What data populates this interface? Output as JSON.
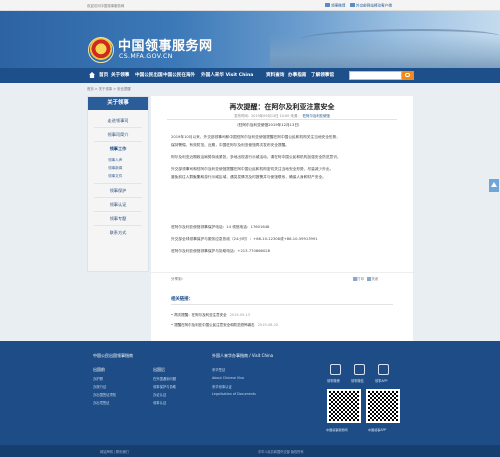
{
  "topbar": {
    "welcome": "欢迎访问中国领事服务网",
    "link_weibo": "领事微博",
    "link_app": "外交部网站移动客户端"
  },
  "header": {
    "title": "中国领事服务网",
    "domain": "CS.MFA.GOV.CN"
  },
  "nav": {
    "items": [
      "首页",
      "关于领事",
      "中国公民出国",
      "中国公民在海外",
      "外国人来华 Visit China",
      "资料查询",
      "办事指南",
      "了解领事馆"
    ]
  },
  "breadcrumb": {
    "items": [
      "首页",
      "关于领事",
      "安全提醒"
    ]
  },
  "sidebar": {
    "heading": "关于领事",
    "items": [
      {
        "label": "走进领事司"
      },
      {
        "label": "领事司简介"
      },
      {
        "label": "领事工作"
      },
      {
        "label": "领事保护"
      },
      {
        "label": "领事认证"
      },
      {
        "label": "领事专题"
      },
      {
        "label": "联系方式"
      }
    ],
    "subitems": [
      "领事人声",
      "领事新闻",
      "领事文件"
    ]
  },
  "article": {
    "title": "再次提醒：在阿尔及利亚注意安全",
    "meta_date": "发布时间：2019年09月13日 15:00  来源：",
    "meta_source": "驻阿尔及利亚使馆",
    "note": "（驻阿尔及利亚使馆2019年12月13日）",
    "paragraphs": [
      "2019年10月以来，外交部领事司和中国驻阿尔及利亚使馆提醒在阿中国公民和机构关注当地安全形势，",
      "保持警惕，有效防范。近期，中国驻阿尔及利亚使馆再次发布安全提醒。",
      "阿尔及利亚近期政治局势持续紧张，多地出现游行示威活动，请在阿中国公民和机构加强安全防范意识。",
      "外交部领事司和驻阿尔及利亚使馆提醒在阿中国公民和机构密切关注当地安全形势，尽量减少外出，",
      "避免前往人群聚集和游行示威区域，遇突发情况及时报警并与使馆联系，确保人身和财产安全。",
      "外交部全球领事保护与服务应急热线（24小时）：+86-10-12308或+86-10-59913991",
      "驻阿尔及利亚使馆领事保护与协助电话：+213-770866028"
    ],
    "hotline": "外交部全球领事保护与服务应急热线（24小时）：+86-10-12308或+86-10-59913991",
    "embassy_phone_label": "驻阿尔及利亚使馆领事保护电话：14  领馆电话：17601648",
    "embassy_phone": "驻阿尔及利亚使馆领事保护与协助电话：+213-770866028"
  },
  "share": {
    "label": "分享到：",
    "actions": [
      "打印",
      "关闭"
    ]
  },
  "related": {
    "title": "相关链接：",
    "items": [
      {
        "text": "再次提醒：在阿尔及利亚注意安全",
        "date": "2019-09-13"
      },
      {
        "text": "提醒在阿尔及利亚中国公民注意安全和防范恐怖袭击",
        "date": "2019-08-20"
      }
    ]
  },
  "footer": {
    "left_heading": "中国公民出国领事指南",
    "mid_heading": "外国人来华办事指南 / Visit China",
    "col1_title": "出国前",
    "col1_items": [
      "办护照",
      "办旅行证",
      "办出国签证须知",
      "办出境签证"
    ],
    "col2_title": "出国后",
    "col2_items": [
      "在外国遇到问题",
      "领事保护与协助",
      "办证认证",
      "领事认证"
    ],
    "col3_items": [
      "来华签证",
      "About Chinese Visa",
      "来华领事认证",
      "Legalisation of Documents"
    ],
    "icons": [
      "领事微博",
      "领事微信",
      "领事APP"
    ],
    "qr_labels": [
      "中国领事服务网",
      "中国领事APP"
    ]
  },
  "bottombar": {
    "left": "网站声明 | 联系我们",
    "right": "中华人民共和国外交部 版权所有"
  }
}
